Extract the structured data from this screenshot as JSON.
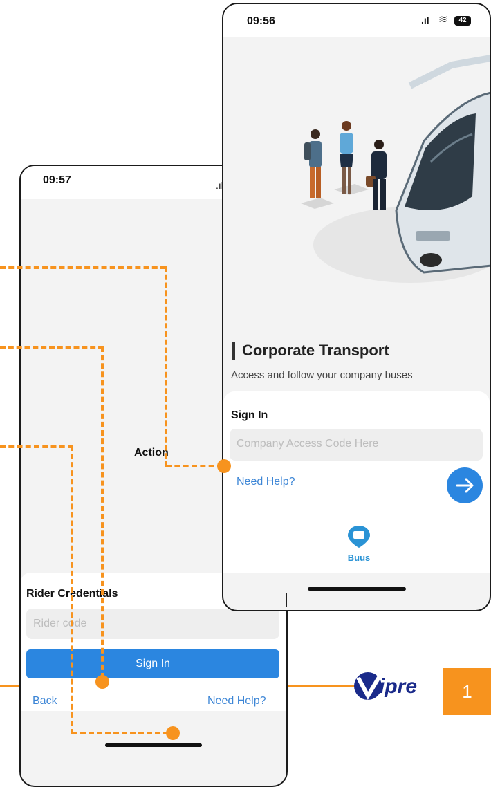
{
  "colors": {
    "accent": "#f7931e",
    "primary_button": "#2b86e0",
    "link": "#3d86d6"
  },
  "rider_screen": {
    "status_time": "09:57",
    "action_label": "Action",
    "credentials_title": "Rider Credentials",
    "rider_code_placeholder": "Rider code",
    "sign_in_button": "Sign In",
    "back_link": "Back",
    "need_help_link": "Need Help?"
  },
  "company_screen": {
    "status_time": "09:56",
    "battery_level": "42",
    "title": "Corporate Transport",
    "subtitle": "Access and follow your company buses",
    "sign_in_title": "Sign In",
    "access_code_placeholder": "Company Access Code Here",
    "need_help_link": "Need Help?",
    "next_icon": "arrow-right-icon",
    "logo_text": "Buus"
  },
  "brand": {
    "logo_text": "ipre",
    "page_number": "1"
  }
}
